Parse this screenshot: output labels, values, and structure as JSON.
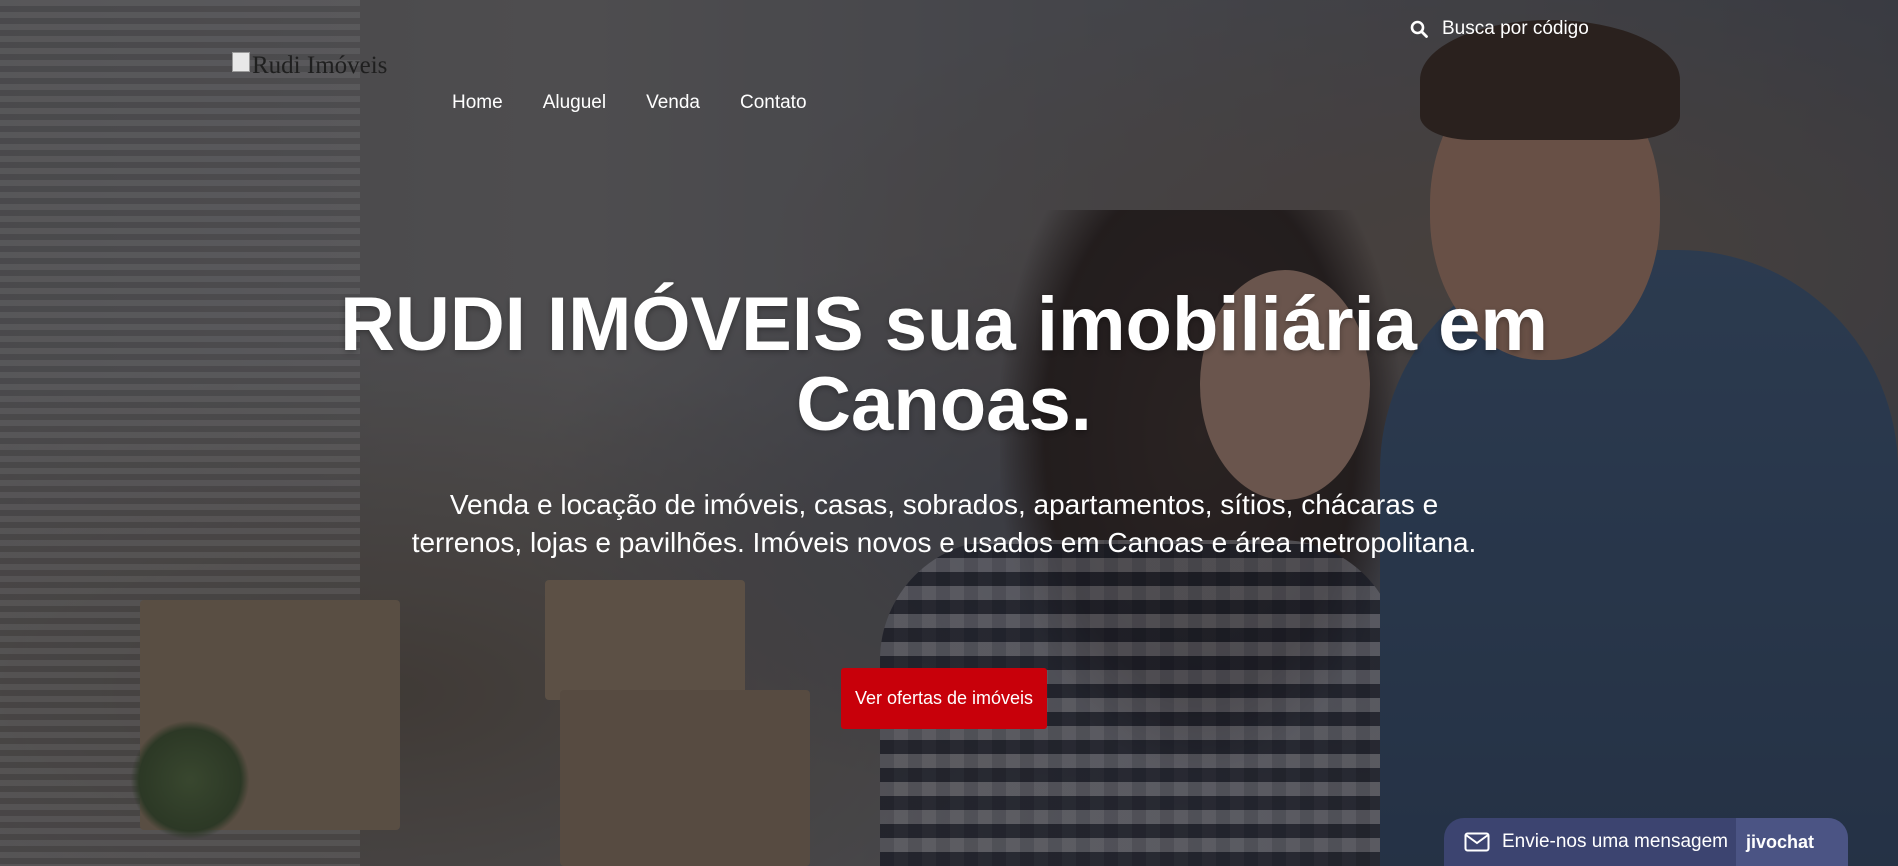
{
  "header": {
    "logo_alt": "Rudi Imóveis",
    "nav": [
      {
        "label": "Home"
      },
      {
        "label": "Aluguel"
      },
      {
        "label": "Venda"
      },
      {
        "label": "Contato"
      }
    ],
    "search_label": "Busca por código"
  },
  "hero": {
    "title_line1": "RUDI IMÓVEIS sua imobiliária em",
    "title_line2": "Canoas.",
    "subtitle": "Venda e locação de imóveis, casas, sobrados, apartamentos, sítios, chácaras e terrenos, lojas e pavilhões. Imóveis novos e usados em Canoas e área metropolitana.",
    "cta_label": "Ver ofertas de imóveis",
    "cta_color": "#c8000a"
  },
  "chat": {
    "label": "Envie-nos uma mensagem",
    "brand": "jivochat",
    "icon": "mail-icon",
    "color": "#3c4470"
  }
}
